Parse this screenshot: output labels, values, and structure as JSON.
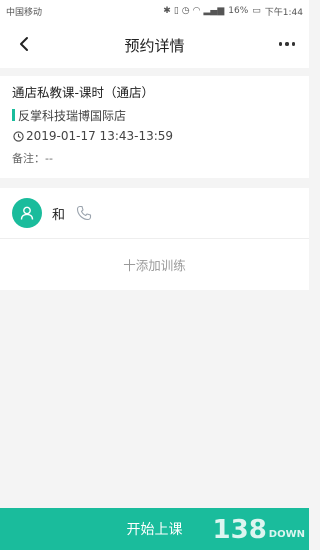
{
  "status_bar": {
    "carrier": "中国移动",
    "battery": "16%",
    "time": "下午1:44"
  },
  "header": {
    "title": "预约详情"
  },
  "detail": {
    "course_name": "通店私教课-课时（通店）",
    "store": "反掌科技瑞博国际店",
    "time": "2019-01-17 13:43-13:59",
    "note_label": "备注：",
    "note_value": "--"
  },
  "member": {
    "name": "和"
  },
  "actions": {
    "add_training": "十添加训练",
    "start_button": "开始上课"
  },
  "watermark": {
    "number": "138",
    "word": "DOWN"
  },
  "colors": {
    "accent": "#1abc9c",
    "background": "#f4f4f4"
  }
}
